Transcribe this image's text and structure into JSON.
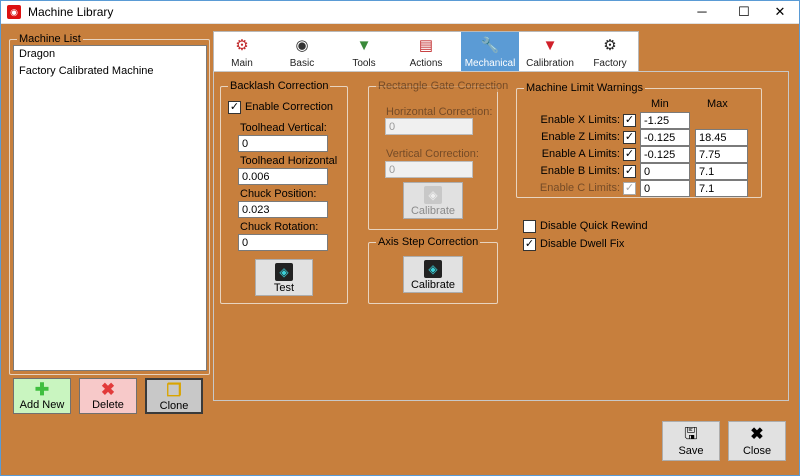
{
  "window": {
    "title": "Machine Library",
    "minimize": "─",
    "maximize": "☐",
    "close": "✕"
  },
  "machine_list": {
    "legend": "Machine List",
    "items": [
      "Dragon",
      "Factory Calibrated Machine"
    ]
  },
  "list_buttons": {
    "add_new": "Add New",
    "delete": "Delete",
    "clone": "Clone"
  },
  "tabs": [
    {
      "label": "Main",
      "icon": "⚙"
    },
    {
      "label": "Basic",
      "icon": "◉"
    },
    {
      "label": "Tools",
      "icon": "▼"
    },
    {
      "label": "Actions",
      "icon": "▤"
    },
    {
      "label": "Mechanical",
      "icon": "🔧"
    },
    {
      "label": "Calibration",
      "icon": "▼"
    },
    {
      "label": "Factory",
      "icon": "⚙"
    }
  ],
  "backlash": {
    "legend": "Backlash Correction",
    "enable_label": "Enable Correction",
    "enable_checked": true,
    "toolhead_vertical_label": "Toolhead Vertical:",
    "toolhead_vertical": "0",
    "toolhead_horizontal_label": "Toolhead Horizontal",
    "toolhead_horizontal": "0.006",
    "chuck_position_label": "Chuck Position:",
    "chuck_position": "0.023",
    "chuck_rotation_label": "Chuck Rotation:",
    "chuck_rotation": "0",
    "test_label": "Test"
  },
  "rect_gate": {
    "legend": "Rectangle Gate Correction",
    "horizontal_label": "Horizontal Correction:",
    "horizontal": "0",
    "vertical_label": "Vertical Correction:",
    "vertical": "0",
    "calibrate_label": "Calibrate"
  },
  "axis_step": {
    "legend": "Axis Step Correction",
    "calibrate_label": "Calibrate"
  },
  "limits": {
    "legend": "Machine Limit Warnings",
    "min_header": "Min",
    "max_header": "Max",
    "rows": [
      {
        "label": "Enable X Limits:",
        "checked": true,
        "min": "-1.25",
        "max": "",
        "disabled": false
      },
      {
        "label": "Enable Z Limits:",
        "checked": true,
        "min": "-0.125",
        "max": "18.45",
        "disabled": false
      },
      {
        "label": "Enable A Limits:",
        "checked": true,
        "min": "-0.125",
        "max": "7.75",
        "disabled": false
      },
      {
        "label": "Enable B Limits:",
        "checked": true,
        "min": "0",
        "max": "7.1",
        "disabled": false
      },
      {
        "label": "Enable C Limits:",
        "checked": true,
        "min": "0",
        "max": "7.1",
        "disabled": true
      }
    ]
  },
  "options": {
    "quick_rewind_label": "Disable Quick Rewind",
    "quick_rewind_checked": false,
    "dwell_fix_label": "Disable Dwell Fix",
    "dwell_fix_checked": true
  },
  "footer": {
    "save": "Save",
    "close": "Close"
  }
}
